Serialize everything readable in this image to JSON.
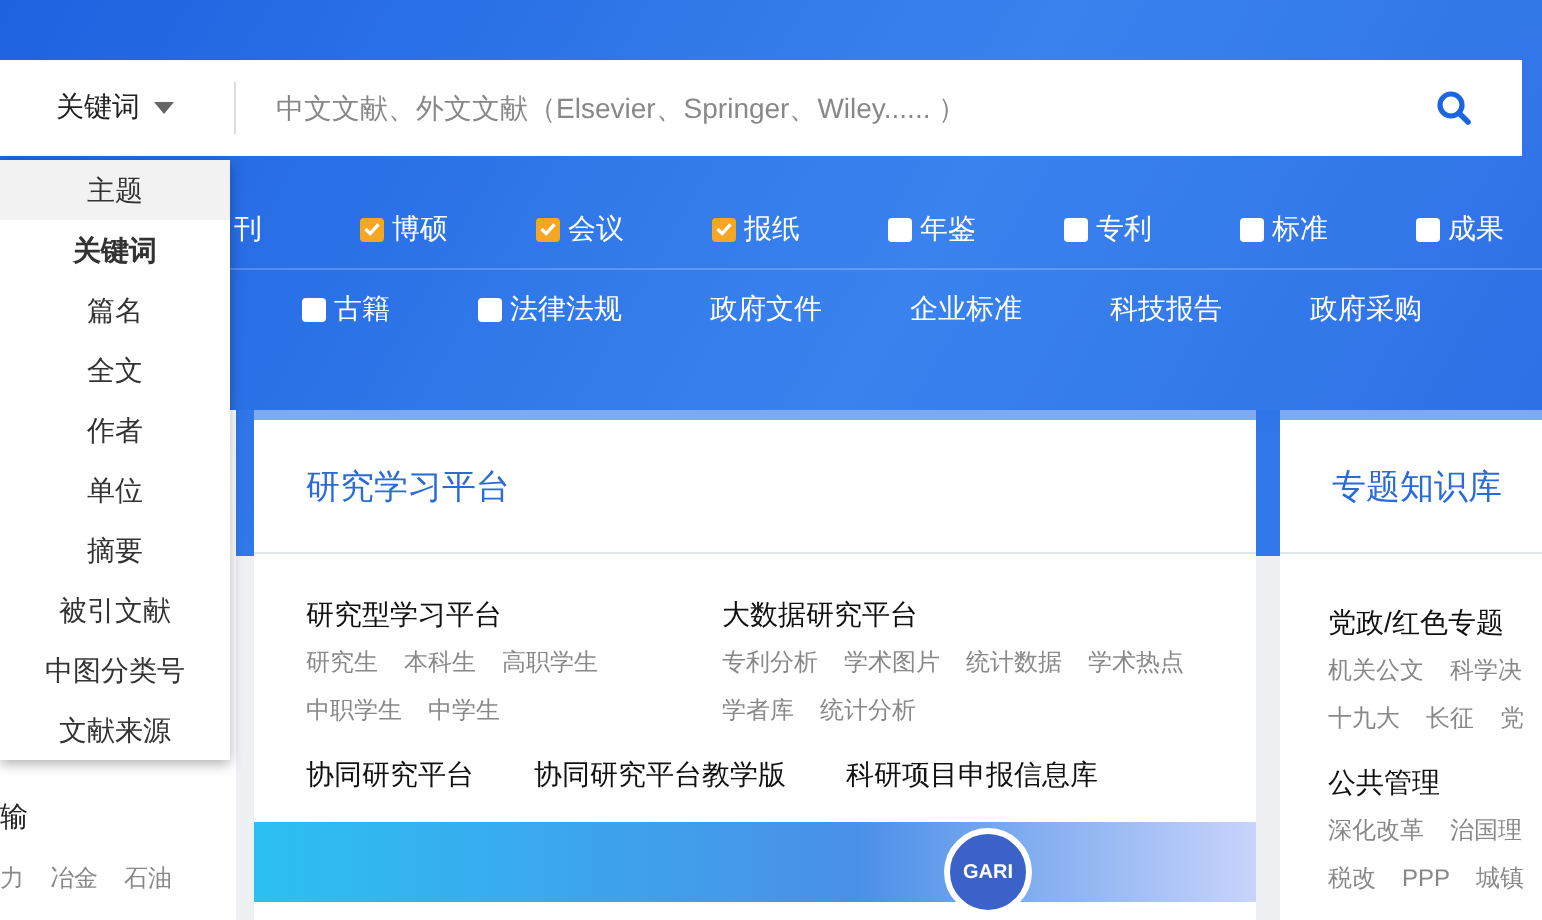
{
  "search": {
    "field_selector": "关键词",
    "placeholder": "中文文献、外文文献（Elsevier、Springer、Wiley...... ）"
  },
  "field_menu": [
    {
      "label": "主题",
      "selected": false,
      "hovered": true
    },
    {
      "label": "关键词",
      "selected": true,
      "hovered": false
    },
    {
      "label": "篇名",
      "selected": false,
      "hovered": false
    },
    {
      "label": "全文",
      "selected": false,
      "hovered": false
    },
    {
      "label": "作者",
      "selected": false,
      "hovered": false
    },
    {
      "label": "单位",
      "selected": false,
      "hovered": false
    },
    {
      "label": "摘要",
      "selected": false,
      "hovered": false
    },
    {
      "label": "被引文献",
      "selected": false,
      "hovered": false
    },
    {
      "label": "中图分类号",
      "selected": false,
      "hovered": false
    },
    {
      "label": "文献来源",
      "selected": false,
      "hovered": false
    }
  ],
  "source_rows": [
    [
      {
        "kind": "text",
        "label": "刊"
      },
      {
        "kind": "checkbox",
        "label": "博硕",
        "checked": true
      },
      {
        "kind": "checkbox",
        "label": "会议",
        "checked": true
      },
      {
        "kind": "checkbox",
        "label": "报纸",
        "checked": true
      },
      {
        "kind": "checkbox",
        "label": "年鉴",
        "checked": false
      },
      {
        "kind": "checkbox",
        "label": "专利",
        "checked": false
      },
      {
        "kind": "checkbox",
        "label": "标准",
        "checked": false
      },
      {
        "kind": "checkbox",
        "label": "成果",
        "checked": false
      }
    ],
    [
      {
        "kind": "checkbox",
        "label": "古籍",
        "checked": false
      },
      {
        "kind": "checkbox",
        "label": "法律法规",
        "checked": false
      },
      {
        "kind": "text",
        "label": "政府文件"
      },
      {
        "kind": "text",
        "label": "企业标准"
      },
      {
        "kind": "text",
        "label": "科技报告"
      },
      {
        "kind": "text",
        "label": "政府采购"
      }
    ]
  ],
  "left_card": {
    "heading": "输",
    "links": [
      "力",
      "冶金",
      "石油"
    ]
  },
  "research_card": {
    "title": "研究学习平台",
    "groups": [
      {
        "heading": "研究型学习平台",
        "link_rows": [
          [
            "研究生",
            "本科生",
            "高职学生"
          ],
          [
            "中职学生",
            "中学生"
          ]
        ]
      },
      {
        "heading": "大数据研究平台",
        "link_rows": [
          [
            "专利分析",
            "学术图片",
            "统计数据",
            "学术热点"
          ],
          [
            "学者库",
            "统计分析"
          ]
        ]
      }
    ],
    "platforms": [
      "协同研究平台",
      "协同研究平台教学版",
      "科研项目申报信息库"
    ],
    "banner": {
      "badge": "GARI"
    }
  },
  "topics_card": {
    "title": "专题知识库",
    "groups": [
      {
        "heading": "党政/红色专题",
        "link_rows": [
          [
            "机关公文",
            "科学决"
          ],
          [
            "十九大",
            "长征",
            "党"
          ]
        ]
      },
      {
        "heading": "公共管理",
        "link_rows": [
          [
            "深化改革",
            "治国理"
          ],
          [
            "税改",
            "PPP",
            "城镇"
          ]
        ]
      }
    ]
  }
}
